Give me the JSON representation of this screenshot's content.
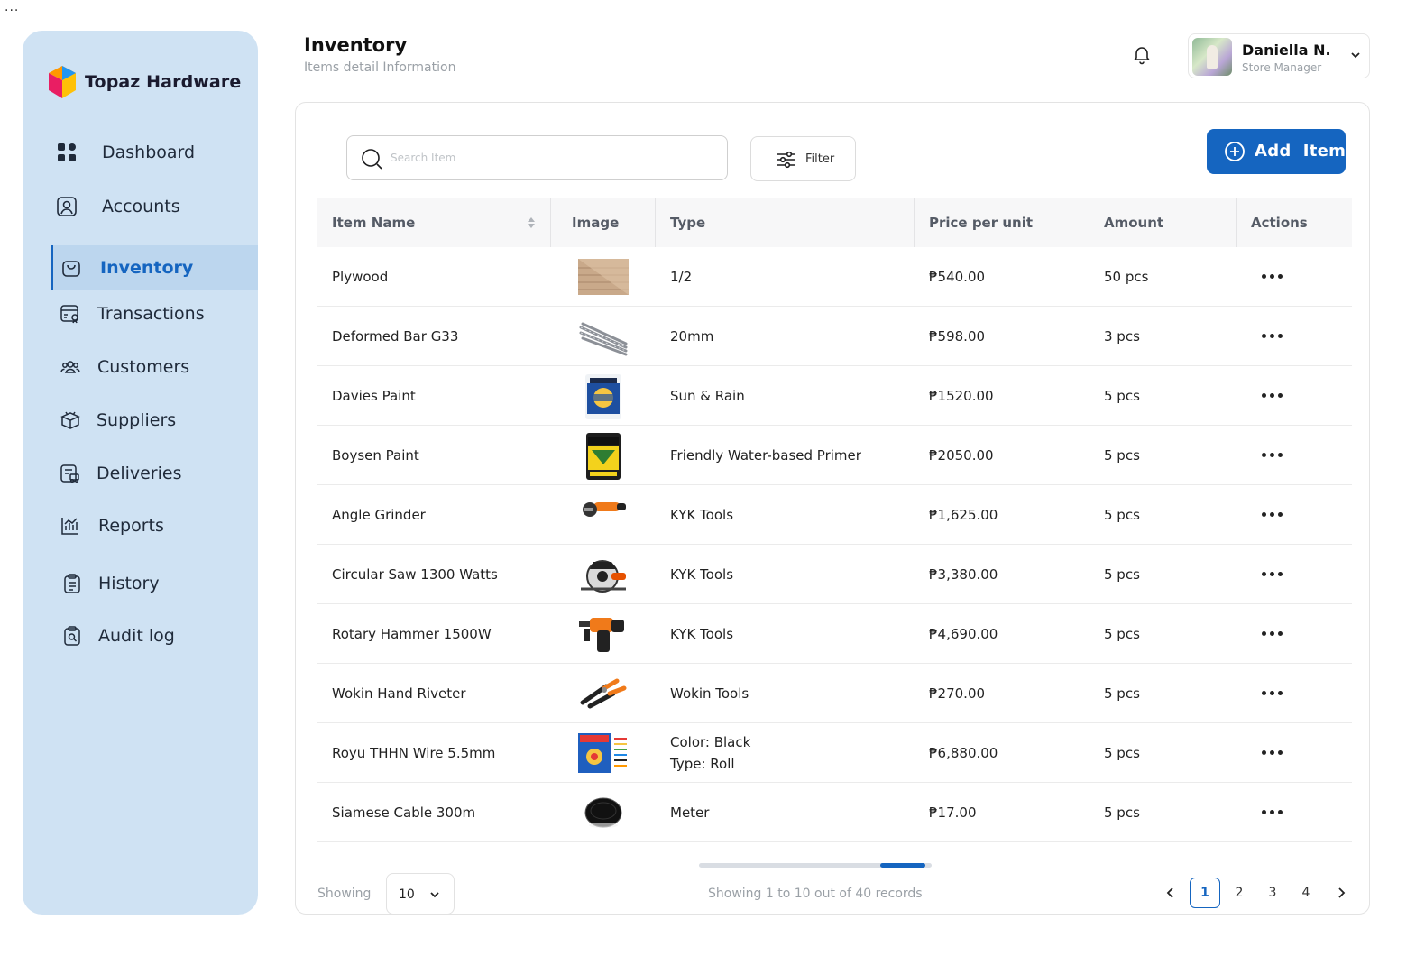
{
  "top_menu": "...",
  "brand": {
    "name": "Topaz Hardware"
  },
  "sidebar": {
    "items": [
      {
        "label": "Dashboard",
        "icon": "grid-icon"
      },
      {
        "label": "Accounts",
        "icon": "account-icon"
      },
      {
        "label": "Inventory",
        "icon": "bag-icon",
        "active": true
      },
      {
        "label": "Transactions",
        "icon": "transactions-icon"
      },
      {
        "label": "Customers",
        "icon": "customers-icon"
      },
      {
        "label": "Suppliers",
        "icon": "box-icon"
      },
      {
        "label": "Deliveries",
        "icon": "delivery-icon"
      },
      {
        "label": "Reports",
        "icon": "chart-icon"
      },
      {
        "label": "History",
        "icon": "clipboard-icon"
      },
      {
        "label": "Audit log",
        "icon": "audit-icon"
      }
    ]
  },
  "header": {
    "title": "Inventory",
    "subtitle": "Items detail Information"
  },
  "user": {
    "name": "Daniella N.",
    "role": "Store Manager"
  },
  "toolbar": {
    "search_placeholder": "Search Item",
    "filter_label": "Filter",
    "add_label": "Add  Item"
  },
  "table": {
    "columns": [
      "Item Name",
      "Image",
      "Type",
      "Price per unit",
      "Amount",
      "Actions"
    ],
    "rows": [
      {
        "name": "Plywood",
        "image": "plywood",
        "type": [
          "1/2"
        ],
        "price": "₱540.00",
        "amount": "50 pcs"
      },
      {
        "name": "Deformed Bar G33",
        "image": "rebar",
        "type": [
          "20mm"
        ],
        "price": "₱598.00",
        "amount": "3 pcs"
      },
      {
        "name": "Davies Paint",
        "image": "davies-paint",
        "type": [
          "Sun & Rain"
        ],
        "price": "₱1520.00",
        "amount": "5 pcs"
      },
      {
        "name": "Boysen Paint",
        "image": "boysen-paint",
        "type": [
          "Friendly Water-based Primer"
        ],
        "price": "₱2050.00",
        "amount": "5 pcs"
      },
      {
        "name": "Angle Grinder",
        "image": "angle-grinder",
        "type": [
          "KYK Tools"
        ],
        "price": "₱1,625.00",
        "amount": "5 pcs"
      },
      {
        "name": "Circular Saw 1300 Watts",
        "image": "circular-saw",
        "type": [
          "KYK Tools"
        ],
        "price": "₱3,380.00",
        "amount": "5 pcs"
      },
      {
        "name": "Rotary Hammer 1500W",
        "image": "rotary-hammer",
        "type": [
          "KYK Tools"
        ],
        "price": "₱4,690.00",
        "amount": "5 pcs"
      },
      {
        "name": "Wokin Hand Riveter",
        "image": "hand-riveter",
        "type": [
          "Wokin Tools"
        ],
        "price": "₱270.00",
        "amount": "5 pcs"
      },
      {
        "name": "Royu THHN Wire 5.5mm",
        "image": "thhn-wire",
        "type": [
          "Color: Black",
          "Type: Roll"
        ],
        "price": "₱6,880.00",
        "amount": "5 pcs"
      },
      {
        "name": "Siamese Cable 300m",
        "image": "cable-reel",
        "type": [
          "Meter"
        ],
        "price": "₱17.00",
        "amount": "5 pcs"
      }
    ]
  },
  "footer": {
    "showing_label": "Showing",
    "page_size": "10",
    "records_text": "Showing 1 to 10 out of 40 records",
    "pages": [
      "1",
      "2",
      "3",
      "4"
    ],
    "current_page": "1"
  },
  "colors": {
    "accent": "#1565c0",
    "sidebar_bg": "#cfe2f3",
    "sidebar_active": "#bcd6ee"
  }
}
